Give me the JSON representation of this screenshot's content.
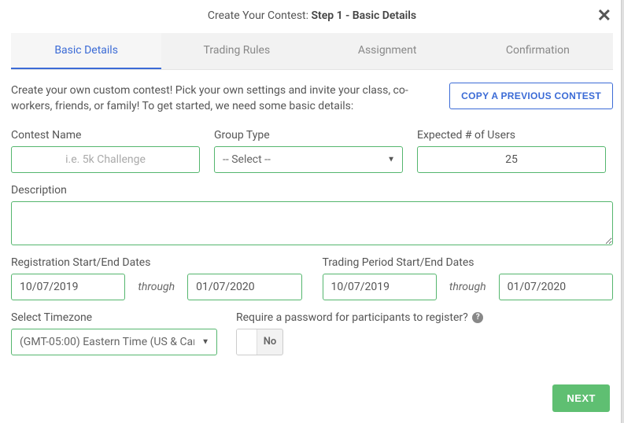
{
  "modal": {
    "title_prefix": "Create Your Contest: ",
    "title_bold": "Step 1 - Basic Details"
  },
  "tabs": {
    "basic": "Basic Details",
    "trading": "Trading Rules",
    "assignment": "Assignment",
    "confirmation": "Confirmation"
  },
  "intro": "Create your own custom contest! Pick your own settings and invite your class, co-workers, friends, or family! To get started, we need some basic details:",
  "copy_button": "COPY A PREVIOUS CONTEST",
  "fields": {
    "contest_name_label": "Contest Name",
    "contest_name_placeholder": "i.e. 5k Challenge",
    "group_type_label": "Group Type",
    "group_type_value": "-- Select --",
    "expected_users_label": "Expected # of Users",
    "expected_users_value": "25",
    "description_label": "Description"
  },
  "dates": {
    "reg_label": "Registration Start/End Dates",
    "reg_start": "10/07/2019",
    "reg_end": "01/07/2020",
    "trade_label": "Trading Period Start/End Dates",
    "trade_start": "10/07/2019",
    "trade_end": "01/07/2020",
    "through": "through"
  },
  "timezone": {
    "label": "Select Timezone",
    "value": "(GMT-05:00) Eastern Time (US & Can"
  },
  "password": {
    "label": "Require a password for participants to register?",
    "toggle_label": "No"
  },
  "footer": {
    "next": "NEXT"
  }
}
